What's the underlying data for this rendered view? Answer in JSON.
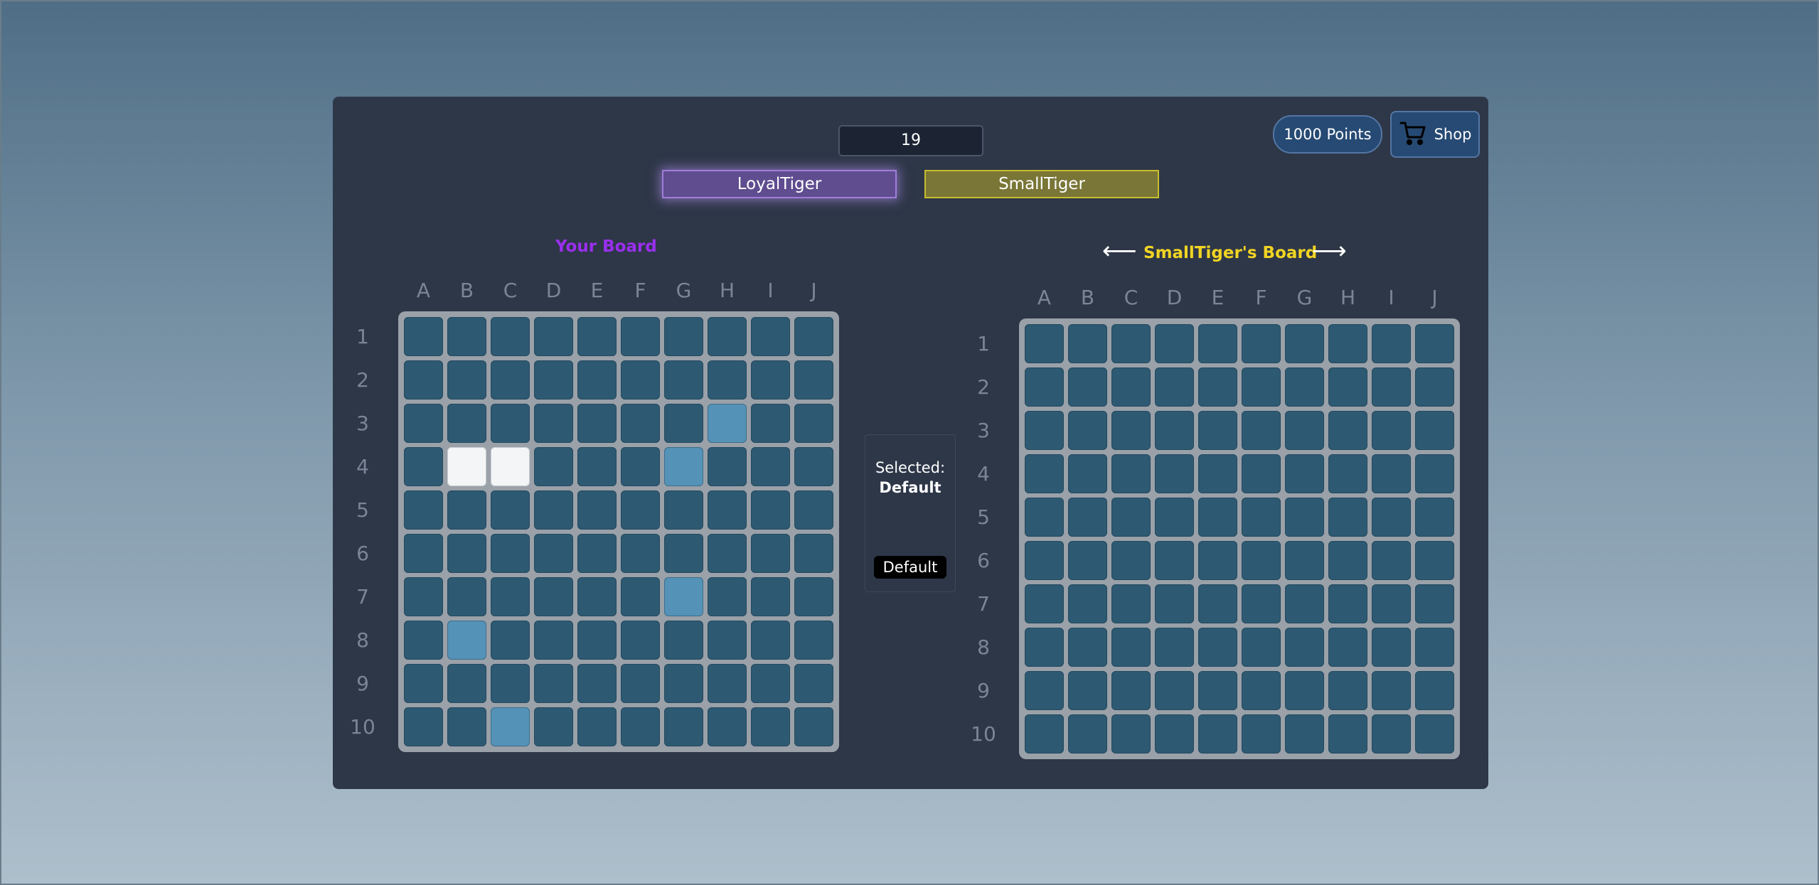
{
  "timer": "19",
  "points_label": "1000 Points",
  "shop_label": "Shop",
  "players": {
    "self": "LoyalTiger",
    "opponent": "SmallTiger"
  },
  "left_board": {
    "title": "Your Board"
  },
  "right_board": {
    "title": "SmallTiger's Board"
  },
  "columns": [
    "A",
    "B",
    "C",
    "D",
    "E",
    "F",
    "G",
    "H",
    "I",
    "J"
  ],
  "rows": [
    "1",
    "2",
    "3",
    "4",
    "5",
    "6",
    "7",
    "8",
    "9",
    "10"
  ],
  "selector": {
    "label": "Selected:",
    "value": "Default",
    "button": "Default"
  },
  "colors": {
    "water": "#2d5a72",
    "miss": "#5493b7",
    "ship": "#f4f5f6",
    "self_accent": "#9b2ff0",
    "opponent_accent": "#f1d422"
  },
  "left_board_cells": {
    "ship": [
      "B4",
      "C4"
    ],
    "miss": [
      "H3",
      "G4",
      "G7",
      "B8",
      "C10"
    ]
  },
  "right_board_cells": {
    "ship": [],
    "miss": []
  }
}
